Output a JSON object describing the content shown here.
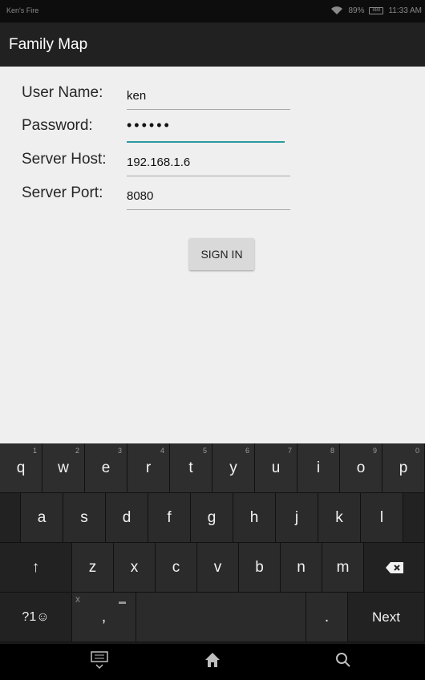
{
  "status_bar": {
    "device_name": "Ken's Fire",
    "battery_percent": "89%",
    "battery_label": "888",
    "time": "11:33 AM"
  },
  "action_bar": {
    "title": "Family Map"
  },
  "form": {
    "username_label": "User Name:",
    "username_value": "ken",
    "password_label": "Password:",
    "password_value": "••••••",
    "host_label": "Server Host:",
    "host_value": "192.168.1.6",
    "port_label": "Server Port:",
    "port_value": "8080",
    "signin_label": "SIGN IN"
  },
  "keyboard": {
    "row1": [
      {
        "key": "q",
        "hint": "1"
      },
      {
        "key": "w",
        "hint": "2"
      },
      {
        "key": "e",
        "hint": "3"
      },
      {
        "key": "r",
        "hint": "4"
      },
      {
        "key": "t",
        "hint": "5"
      },
      {
        "key": "y",
        "hint": "6"
      },
      {
        "key": "u",
        "hint": "7"
      },
      {
        "key": "i",
        "hint": "8"
      },
      {
        "key": "o",
        "hint": "9"
      },
      {
        "key": "p",
        "hint": "0"
      }
    ],
    "row2": [
      "a",
      "s",
      "d",
      "f",
      "g",
      "h",
      "j",
      "k",
      "l"
    ],
    "row3": [
      "z",
      "x",
      "c",
      "v",
      "b",
      "n",
      "m"
    ],
    "shift_symbol": "↑",
    "symbols_label": "?1☺",
    "comma": ",",
    "comma_hint": "X",
    "period": ".",
    "next_label": "Next"
  },
  "nav_bar": {
    "keyboard_icon": "keyboard-hide-icon",
    "home_icon": "home-icon",
    "search_icon": "search-icon"
  },
  "colors": {
    "accent": "#2a9aa0",
    "action_bar": "#212121",
    "content_bg": "#efefef",
    "keyboard_bg": "#1b1b1b"
  }
}
